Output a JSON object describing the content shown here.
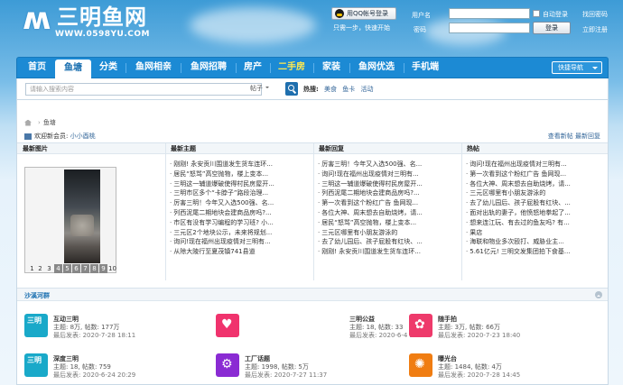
{
  "header": {
    "logo_cn": "三明鱼网",
    "logo_url": "WWW.0598YU.COM",
    "qq_button": "用QQ帐号登录",
    "qq_tip": "只需一步，快速开始",
    "username_label": "用户名",
    "password_label": "密码",
    "remember_label": "自动登录",
    "forgot_link": "找回密码",
    "register_link": "立即注册",
    "login_button": "登录"
  },
  "nav": {
    "items": [
      "首页",
      "鱼塘",
      "分类",
      "鱼网相亲",
      "鱼网招聘",
      "房产",
      "二手房",
      "家装",
      "鱼网优选",
      "手机端"
    ],
    "active_index": 1,
    "highlight_index": 6,
    "quick_nav": "快捷导航"
  },
  "search": {
    "placeholder": "请输入搜索内容",
    "type_label": "帖子",
    "hot_label": "热搜:",
    "hot_terms": [
      "美食",
      "鱼卡",
      "活动"
    ]
  },
  "breadcrumb": {
    "current": "鱼塘"
  },
  "welcome": {
    "prefix": "欢迎新会员:",
    "user": "小小酉桃",
    "links": "查看新帖 最新回复"
  },
  "columns": {
    "photo_title": "最新图片",
    "topics_title": "最新主题",
    "replies_title": "最新回复",
    "hot_title": "热帖",
    "photo_pages": [
      "1",
      "2",
      "3",
      "4",
      "5",
      "6",
      "7",
      "8",
      "9",
      "10"
    ],
    "photo_active_from": 3,
    "photo_active_to": 8,
    "topics": [
      "刚刚! 永安贡川围道发生货车连环...",
      "居民“怒骂”高空抛物，楼上变本...",
      "三明这一辅道爆破使得村民房屋开...",
      "三明市区多个“卡脖子”路段治理...",
      "厉害三明！今年又入选500强、名...",
      "列西泥尾二期地块会建商品房吗?...",
      "市区有没有学习编程的学习班? 小...",
      "三元区2个地块公示，未来将规划...",
      "询问!现在福州出现疫情对三明有...",
      "从除大陵行至夏茂镇741县道"
    ],
    "replies": [
      "厉害三明！今年又入选500强、名...",
      "询问!现在福州出现疫情对三明有...",
      "三明这一辅道爆破使得村民房屋开...",
      "列西泥尾二期地块会建商品房吗?...",
      "第一次看到这个粉红广告 鱼网现...",
      "各位大神、周末想去自助烧烤，请...",
      "居民“怒骂”高空抛物，楼上变本...",
      "三元区哪里有小朋友游泳的",
      "去了幼儿园后、孩子屁股有红块、...",
      "刚刚! 永安贡川围道发生货车连环..."
    ],
    "hot": [
      "询问!现在福州出现疫情对三明有...",
      "第一次看到这个粉红广告 鱼网现...",
      "各位大神、周末想去自助烧烤，请...",
      "三元区哪里有小朋友游泳的",
      "去了幼儿园后、孩子屁股有红块、...",
      "面对出轨的妻子，他愤怒地拳起了...",
      "想来连江玩、有去过的鱼友吗? 有...",
      "果店",
      "海联和物业多次殴打、威胁业主...",
      "5.61亿元! 三明交发集团拍下食基..."
    ]
  },
  "group": {
    "title": "沙溪河群",
    "forums": [
      {
        "name": "互动三明",
        "stats": "主题: 8万, 帖数: 177万",
        "last": "最后发表: 2020-7-28 18:11",
        "color": "#19a9c9",
        "icon": "sanming-logo-icon"
      },
      {
        "name": "鱼讯频道",
        "stats": "主题: 2万, 帖数: 32万",
        "last": "最后发表: 2020-7-28 17:05",
        "color": "#f0336d",
        "icon": "heart-hand-icon"
      },
      {
        "name": "三明公益",
        "stats": "主题: 18, 帖数: 33",
        "last": "最后发表: 2020-6-4 21:37",
        "color": "#f0336d",
        "icon": "heart-hand-icon"
      },
      {
        "name": "随手拍",
        "stats": "主题: 3万, 帖数: 66万",
        "last": "最后发表: 2020-7-23 18:40",
        "color": "#ee3a6b",
        "icon": "camera-icon"
      },
      {
        "name": "深度三明",
        "stats": "主题: 18, 帖数: 759",
        "last": "最后发表: 2020-6-24 20:29",
        "color": "#19a9c9",
        "icon": "sanming-logo-icon"
      },
      {
        "name": "工厂话题",
        "stats": "主题: 1998, 帖数: 5万",
        "last": "最后发表: 2020-7-27 11:37",
        "color": "#8a2bd3",
        "icon": "gear-icon"
      },
      {
        "name": "曝光台",
        "stats": "主题: 1484, 帖数: 4万",
        "last": "最后发表: 2020-7-28 14:45",
        "color": "#f07d12",
        "icon": "bulb-icon"
      }
    ]
  }
}
